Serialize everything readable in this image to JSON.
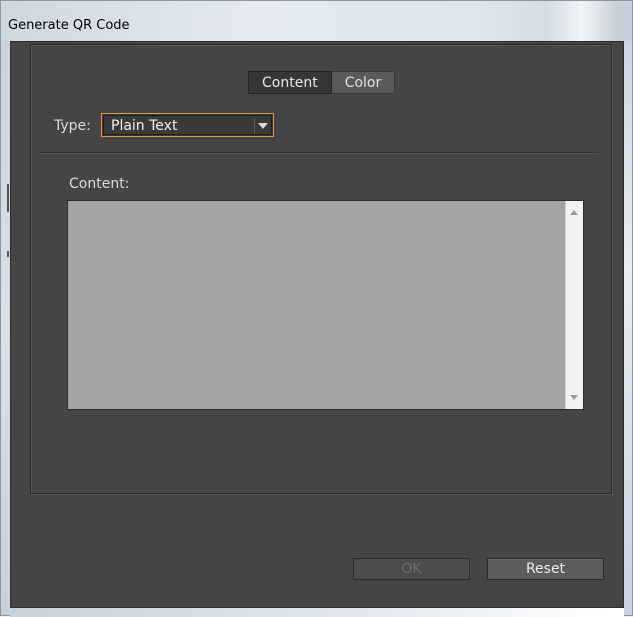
{
  "window": {
    "title": "Generate QR Code"
  },
  "tabs": [
    {
      "label": "Content",
      "active": true
    },
    {
      "label": "Color",
      "active": false
    }
  ],
  "type_field": {
    "label": "Type:",
    "selected": "Plain Text"
  },
  "content_field": {
    "label": "Content:",
    "value": ""
  },
  "buttons": {
    "ok_label": "OK",
    "ok_enabled": false,
    "reset_label": "Reset"
  },
  "colors": {
    "panel_bg": "#454545",
    "focus_accent": "#e8953b",
    "textarea_bg": "#a3a3a3"
  }
}
